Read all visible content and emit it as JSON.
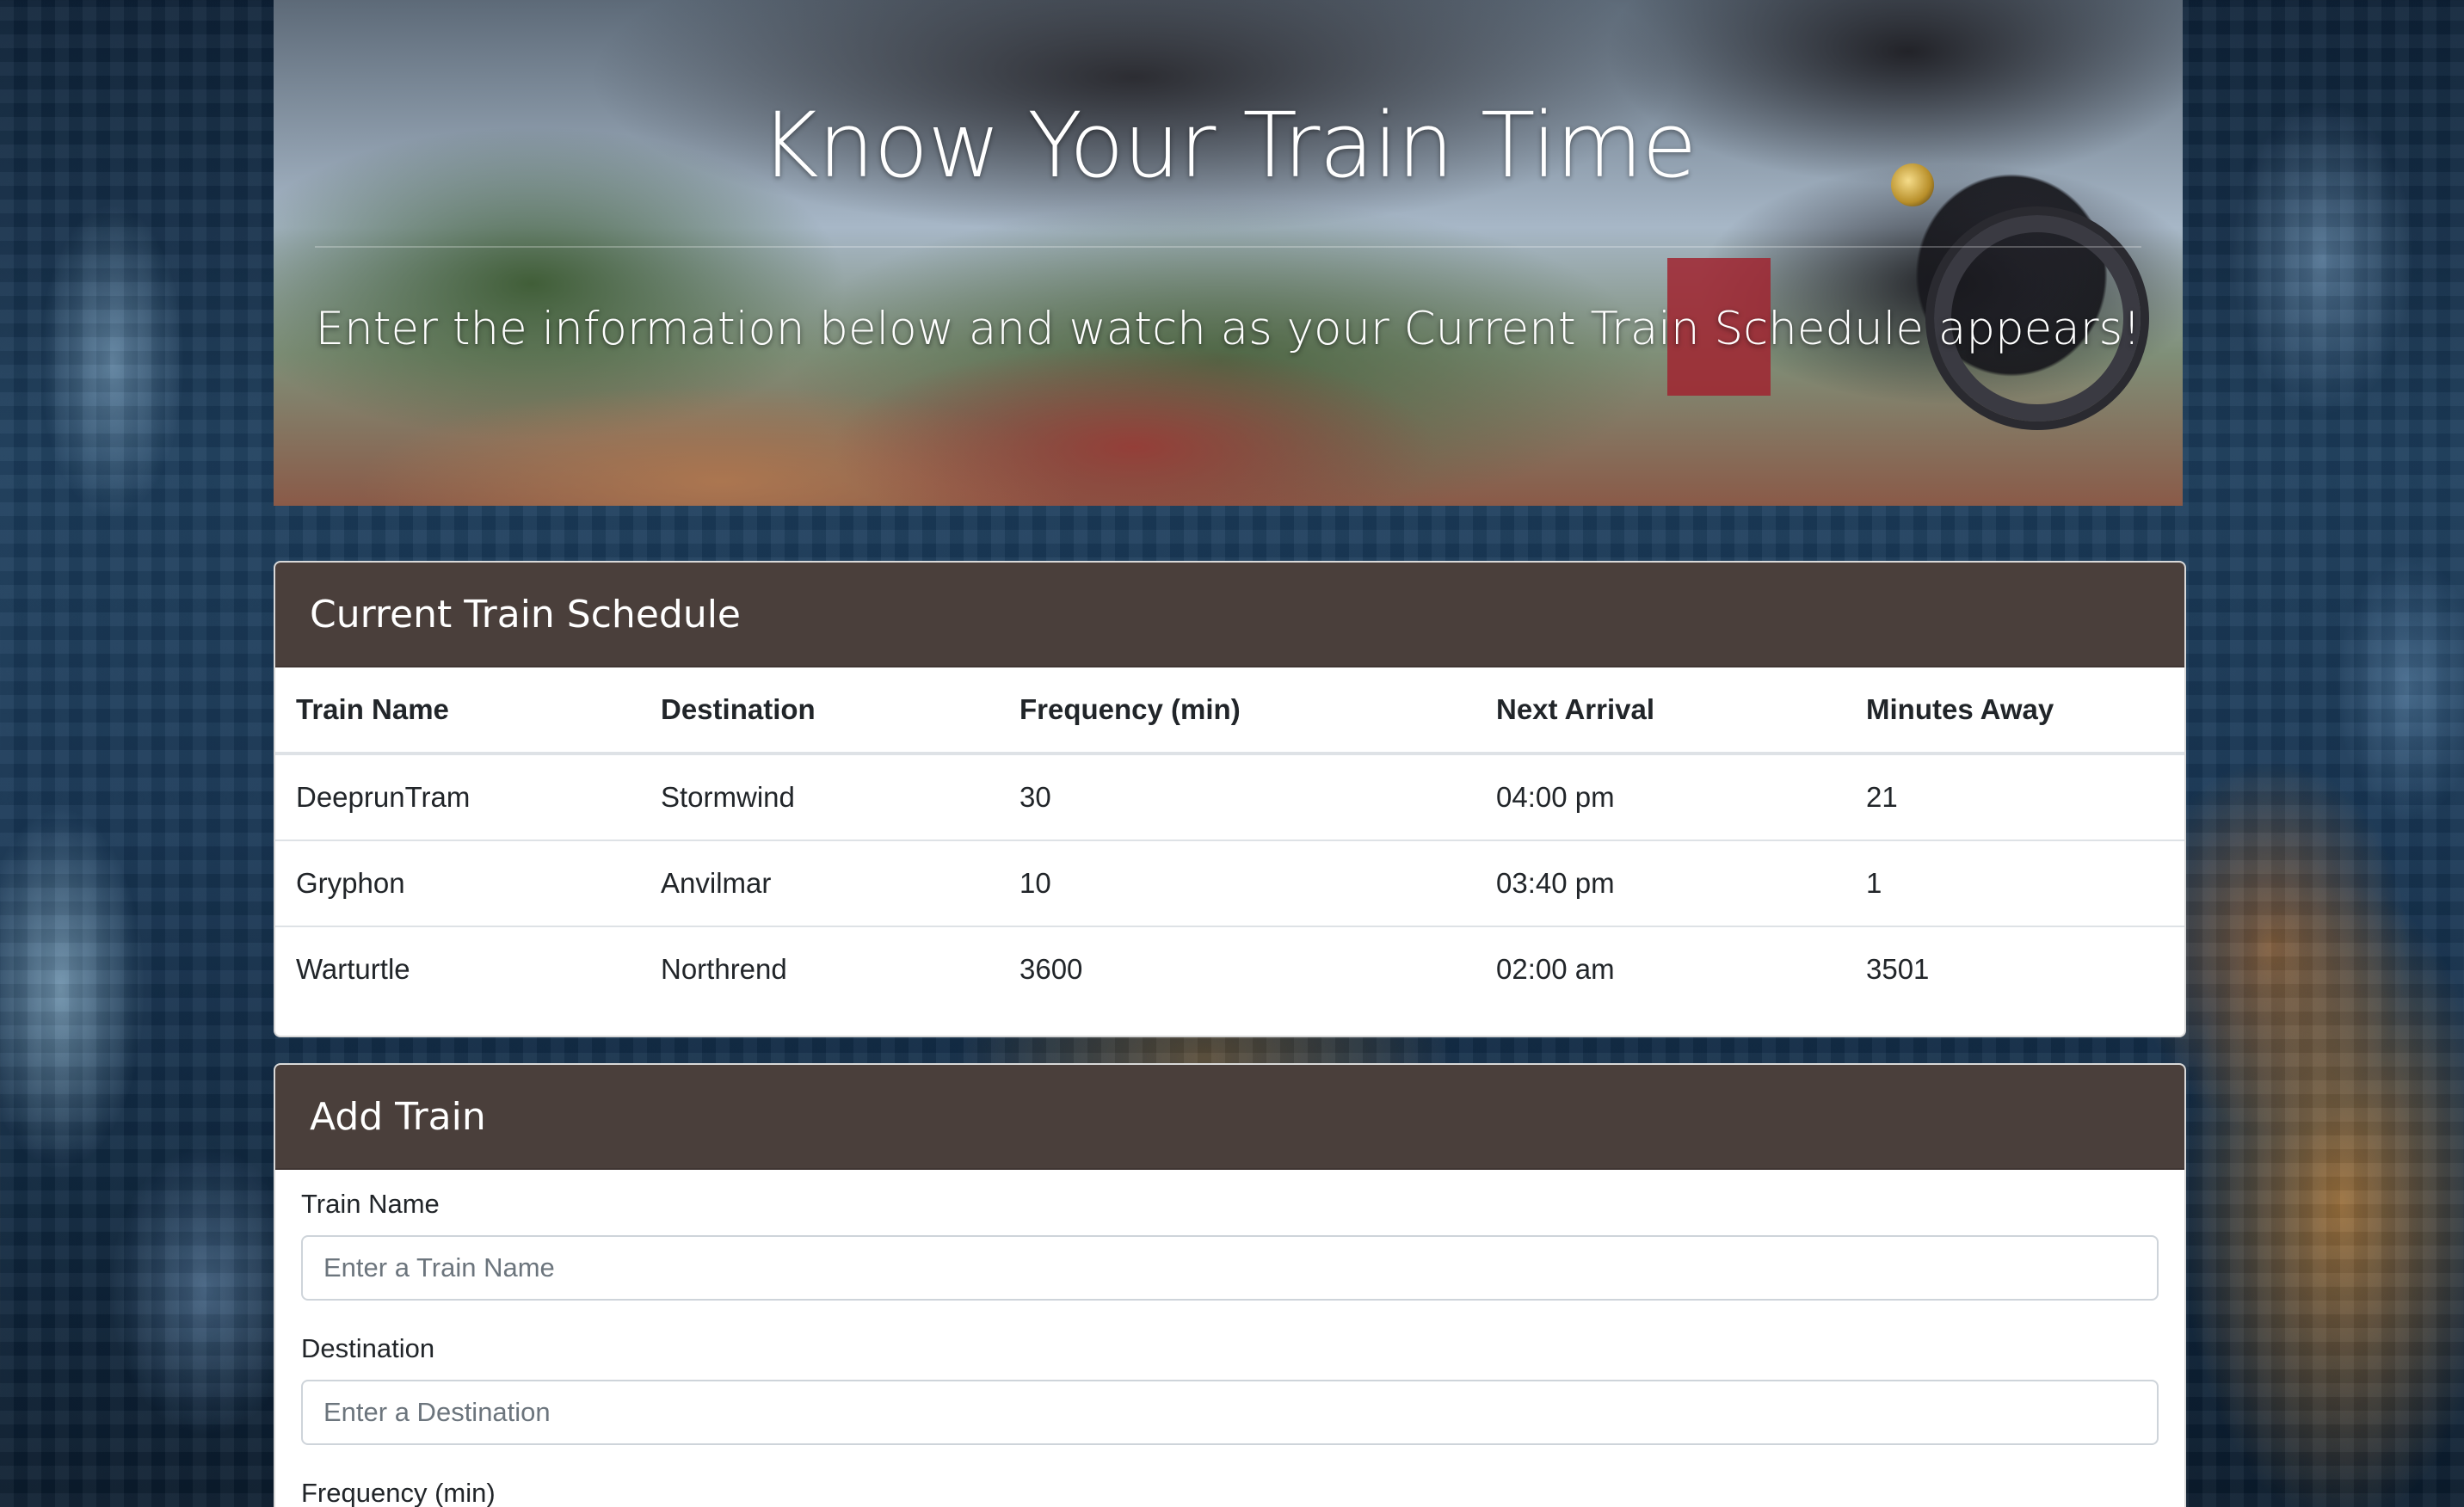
{
  "hero": {
    "title": "Know Your Train Time",
    "lead": "Enter the information below and watch as your Current Train Schedule appears!"
  },
  "schedule": {
    "header": "Current Train Schedule",
    "columns": [
      "Train Name",
      "Destination",
      "Frequency (min)",
      "Next Arrival",
      "Minutes Away"
    ],
    "rows": [
      [
        "DeeprunTram",
        "Stormwind",
        "30",
        "04:00 pm",
        "21"
      ],
      [
        "Gryphon",
        "Anvilmar",
        "10",
        "03:40 pm",
        "1"
      ],
      [
        "Warturtle",
        "Northrend",
        "3600",
        "02:00 am",
        "3501"
      ]
    ]
  },
  "add_train": {
    "header": "Add Train",
    "train_name_label": "Train Name",
    "train_name_placeholder": "Enter a Train Name",
    "destination_label": "Destination",
    "destination_placeholder": "Enter a Destination",
    "frequency_label": "Frequency (min)"
  },
  "colors": {
    "card_header_bg": "#4a3f3b",
    "hero_text": "#ffffff"
  }
}
